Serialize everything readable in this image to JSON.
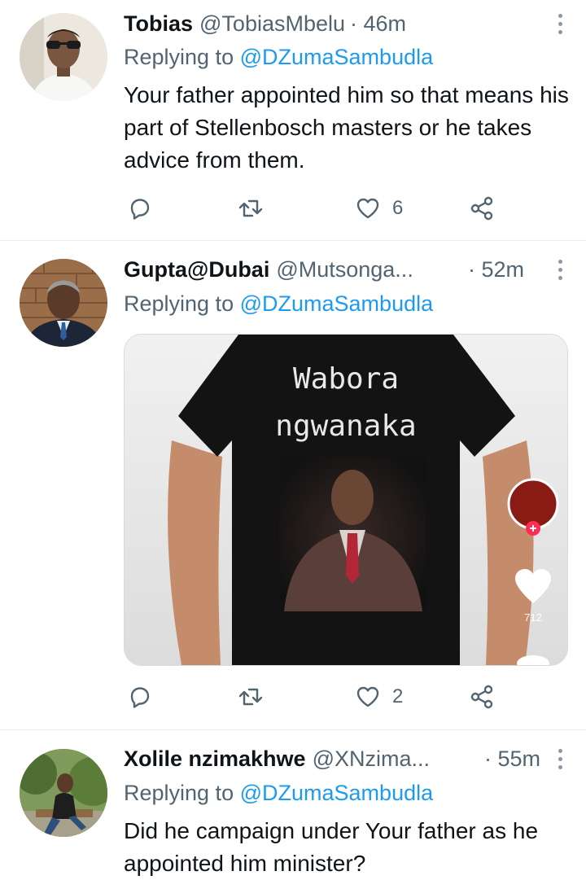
{
  "tweets": [
    {
      "name": "Tobias",
      "handle": "@TobiasMbelu",
      "time": "· 46m",
      "replying_prefix": "Replying to",
      "replying_to": "@DZumaSambudla",
      "text": "Your father appointed him so that means his part of Stellenbosch masters or he takes advice from them.",
      "likes": "6",
      "avatar_icon": "person-sunglasses-avatar"
    },
    {
      "name": "Gupta@Dubai",
      "handle": "@Mutsonga...",
      "time": "· 52m",
      "replying_prefix": "Replying to",
      "replying_to": "@DZumaSambudla",
      "likes": "2",
      "media": {
        "shirt_line1": "Wabora",
        "shirt_line2": "ngwanaka",
        "overlay_count": "712"
      }
    },
    {
      "name": "Xolile nzimakhwe",
      "handle": "@XNzima...",
      "time": "· 55m",
      "replying_prefix": "Replying to",
      "replying_to": "@DZumaSambudla",
      "text": "Did he campaign under Your father as he appointed him minister?"
    }
  ],
  "colors": {
    "accent": "#1d9bf0",
    "secondary": "#536471",
    "divider": "#e6ecf0"
  }
}
